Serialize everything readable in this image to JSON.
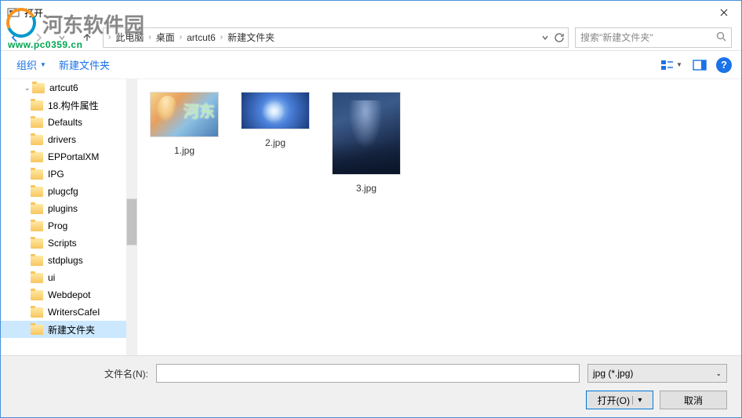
{
  "window": {
    "title": "打开"
  },
  "watermark": {
    "text": "河东软件园",
    "url": "www.pc0359.cn"
  },
  "breadcrumb": {
    "items": [
      "此电脑",
      "桌面",
      "artcut6",
      "新建文件夹"
    ]
  },
  "search": {
    "placeholder": "搜索\"新建文件夹\""
  },
  "toolbar": {
    "organize": "组织",
    "newfolder": "新建文件夹"
  },
  "sidebar": {
    "parent": "artcut6",
    "items": [
      "18.构件属性",
      "Defaults",
      "drivers",
      "EPPortalXM",
      "IPG",
      "plugcfg",
      "plugins",
      "Prog",
      "Scripts",
      "stdplugs",
      "ui",
      "Webdepot",
      "WritersCafeI",
      "新建文件夹"
    ],
    "selected": "新建文件夹"
  },
  "files": [
    {
      "name": "1.jpg",
      "thumb": "h1"
    },
    {
      "name": "2.jpg",
      "thumb": "h2"
    },
    {
      "name": "3.jpg",
      "thumb": "h3"
    }
  ],
  "footer": {
    "filename_label": "文件名(N):",
    "filename_value": "",
    "filter": "jpg (*.jpg)",
    "open": "打开(O)",
    "cancel": "取消"
  }
}
